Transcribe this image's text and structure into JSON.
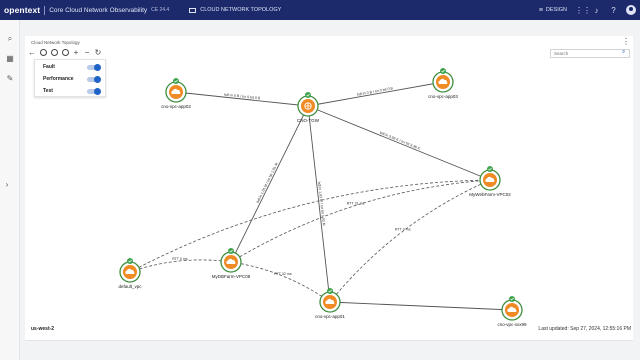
{
  "topbar": {
    "brand": "opentext",
    "product": "Core Cloud Network Observability",
    "version": "CE 24.4",
    "tab_label": "CLOUD NETWORK TOPOLOGY",
    "design_label": "DESIGN"
  },
  "page": {
    "breadcrumb": "Cloud Network Topology",
    "search_placeholder": "Search"
  },
  "filters": [
    {
      "label": "Fault",
      "enabled": true
    },
    {
      "label": "Performance",
      "enabled": true
    },
    {
      "label": "Test",
      "enabled": true
    }
  ],
  "nodes": [
    {
      "id": "cno-vpc-app02",
      "label": "cno-vpc-app02",
      "kind": "cloud",
      "status": "ok"
    },
    {
      "id": "cno-tgw",
      "label": "CNO-TGW",
      "kind": "gateway",
      "status": "ok"
    },
    {
      "id": "cno-vpc-app03",
      "label": "cno-vpc-app03",
      "kind": "cloud",
      "status": "ok"
    },
    {
      "id": "mywebfarm",
      "label": "MyWebFarm-VPC02",
      "kind": "cloud",
      "status": "ok"
    },
    {
      "id": "default-vpc",
      "label": "default_vpc",
      "kind": "cloud",
      "status": "ok"
    },
    {
      "id": "mydbfarm",
      "label": "MyDBFarm-VPC08",
      "kind": "cloud",
      "status": "ok"
    },
    {
      "id": "cno-vpc-app01",
      "label": "cno-vpc-app01",
      "kind": "cloud",
      "status": "ok"
    },
    {
      "id": "cno-vpc-xxx",
      "label": "cno-vpc-xxx99",
      "kind": "cloud",
      "status": "ok"
    }
  ],
  "edges": [
    {
      "from": "cno-vpc-app02",
      "to": "cno-tgw",
      "label": "bdl:in 0 B / txr 0 bit 0 B",
      "style": "solid"
    },
    {
      "from": "cno-tgw",
      "to": "cno-vpc-app03",
      "label": "bdl:in 0 B / txr 0 bit 0 B",
      "style": "solid"
    },
    {
      "from": "cno-tgw",
      "to": "mywebfarm",
      "label": "bdl:in 3.56 K / txr bit 3.36 K",
      "style": "solid"
    },
    {
      "from": "cno-tgw",
      "to": "mydbfarm",
      "label": "bdl:in 1.01 M / txr bit 1.01 M",
      "style": "solid"
    },
    {
      "from": "cno-tgw",
      "to": "cno-vpc-app01",
      "label": "bdl:in 1.03 M / txr bit 1.03 M",
      "style": "solid"
    },
    {
      "from": "mydbfarm",
      "to": "mywebfarm",
      "label": "RTT 31 ms",
      "style": "dashed"
    },
    {
      "from": "default-vpc",
      "to": "mydbfarm",
      "label": "RTT 0 ms",
      "style": "dashed"
    },
    {
      "from": "default-vpc",
      "to": "mywebfarm",
      "label": "",
      "style": "dashed"
    },
    {
      "from": "mydbfarm",
      "to": "cno-vpc-app01",
      "label": "RTT 32 ms",
      "style": "dashed"
    },
    {
      "from": "cno-vpc-app01",
      "to": "mywebfarm",
      "label": "RTT 0 ms",
      "style": "dashed"
    },
    {
      "from": "cno-vpc-app01",
      "to": "cno-vpc-xxx",
      "label": "",
      "style": "solid"
    }
  ],
  "footer": {
    "region": "us-west-2",
    "last_updated": "Last updated: Sep 27, 2024, 12:55:16 PM"
  },
  "colors": {
    "topbar": "#1c2a6b",
    "node_ring": "#3e8e3e",
    "node_fill": "#f08a24",
    "status_badge": "#3fa34d",
    "toggle": "#1f63c6"
  }
}
